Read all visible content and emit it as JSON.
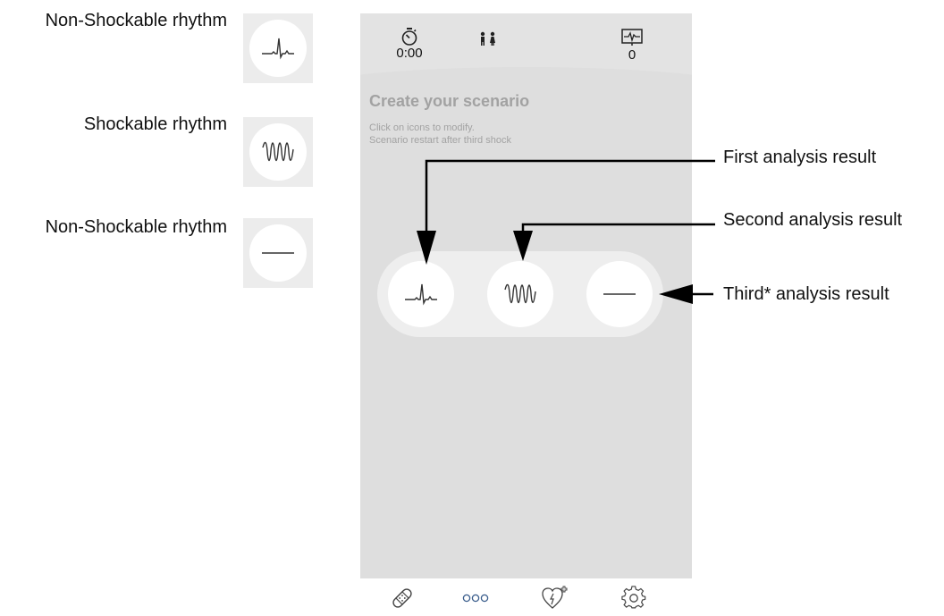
{
  "legend": [
    {
      "label": "Non-Shockable rhythm",
      "icon": "sinus-rhythm-icon"
    },
    {
      "label": "Shockable rhythm",
      "icon": "fibrillation-icon"
    },
    {
      "label": "Non-Shockable rhythm",
      "icon": "flatline-icon"
    }
  ],
  "phone": {
    "header": {
      "timer_icon": "stopwatch-icon",
      "timer_value": "0:00",
      "patient_icon": "child-adult-icon",
      "shock_icon": "ecg-monitor-icon",
      "shock_count": "0"
    },
    "title": "Create your scenario",
    "subtitle_line1": "Click on icons to modify.",
    "subtitle_line2": "Scenario restart after third shock",
    "scenario": [
      {
        "icon": "sinus-rhythm-icon"
      },
      {
        "icon": "fibrillation-icon"
      },
      {
        "icon": "flatline-icon"
      }
    ],
    "nav": [
      {
        "icon": "bandage-icon"
      },
      {
        "icon": "scenario-dots-icon"
      },
      {
        "icon": "heart-shock-icon"
      },
      {
        "icon": "settings-gear-icon"
      }
    ]
  },
  "callouts": {
    "first": "First analysis result",
    "second": "Second analysis result",
    "third": "Third* analysis result"
  },
  "colors": {
    "phone_bg": "#e3e3e3",
    "pill_bg": "#eeeeee",
    "title_gray": "#a2a2a2",
    "line": "#000000"
  }
}
